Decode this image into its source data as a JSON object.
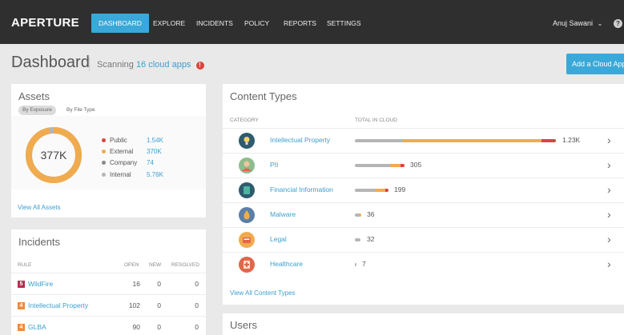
{
  "nav": {
    "logo": "APERTURE",
    "items": [
      "DASHBOARD",
      "EXPLORE",
      "INCIDENTS",
      "POLICY",
      "REPORTS",
      "SETTINGS"
    ],
    "user": "Anuj Sawani",
    "help": "?"
  },
  "header": {
    "title": "Dashboard",
    "scanning_prefix": "Scanning",
    "scanning_link": "16 cloud apps",
    "warning": "!",
    "add_button": "Add a Cloud App"
  },
  "assets": {
    "title": "Assets",
    "toggles": [
      "By Exposure",
      "By File Type"
    ],
    "total": "377K",
    "legend": [
      {
        "label": "Public",
        "value": "1.54K",
        "color": "#d9453d"
      },
      {
        "label": "External",
        "value": "370K",
        "color": "#f0ab4f"
      },
      {
        "label": "Company",
        "value": "74",
        "color": "#888888"
      },
      {
        "label": "Internal",
        "value": "5.76K",
        "color": "#b5b5b5"
      }
    ],
    "view_all": "View All Assets"
  },
  "incidents": {
    "title": "Incidents",
    "headers": {
      "rule": "RULE",
      "open": "OPEN",
      "new": "NEW",
      "resolved": "RESOLVED"
    },
    "rows": [
      {
        "severity": "5",
        "color": "#b5304f",
        "rule": "WildFire",
        "open": "16",
        "new": "0",
        "resolved": "0"
      },
      {
        "severity": "4",
        "color": "#ef8a3c",
        "rule": "Intellectual Property",
        "open": "102",
        "new": "0",
        "resolved": "0"
      },
      {
        "severity": "4",
        "color": "#ef8a3c",
        "rule": "GLBA",
        "open": "90",
        "new": "0",
        "resolved": "0"
      }
    ]
  },
  "content_types": {
    "title": "Content Types",
    "headers": {
      "category": "CATEGORY",
      "total": "TOTAL IN CLOUD"
    },
    "colors": {
      "internal": "#b5b5b5",
      "external": "#f0ab4f",
      "public": "#d9453d"
    },
    "rows": [
      {
        "name": "Intellectual Property",
        "value": "1.23K",
        "icon": "lightbulb-icon",
        "icon_bg": "#2f5b6d"
      },
      {
        "name": "PII",
        "value": "305",
        "icon": "person-icon",
        "icon_bg": "#8fbc8f"
      },
      {
        "name": "Financial Information",
        "value": "199",
        "icon": "money-icon",
        "icon_bg": "#2f5b6d"
      },
      {
        "name": "Malware",
        "value": "36",
        "icon": "flame-icon",
        "icon_bg": "#5b7fa6"
      },
      {
        "name": "Legal",
        "value": "32",
        "icon": "document-icon",
        "icon_bg": "#f0ab4f"
      },
      {
        "name": "Healthcare",
        "value": "7",
        "icon": "medical-icon",
        "icon_bg": "#e2664a"
      }
    ],
    "view_all": "View All Content Types"
  },
  "users": {
    "title": "Users"
  }
}
